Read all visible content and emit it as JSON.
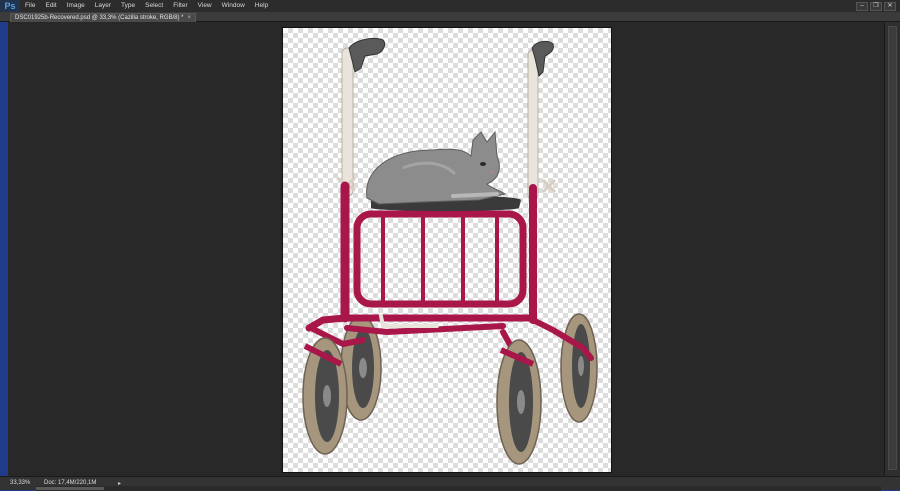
{
  "app": {
    "logo": "Ps",
    "menus": [
      "File",
      "Edit",
      "Image",
      "Layer",
      "Type",
      "Select",
      "Filter",
      "View",
      "Window",
      "Help"
    ],
    "window_controls": [
      "–",
      "❐",
      "✕"
    ]
  },
  "document": {
    "tab_title": "DSC01925b-Recovered.psd @ 33,3% (Cazilla stroke, RGB/8) *",
    "tab_close": "×"
  },
  "status": {
    "zoom": "33,33%",
    "doc_info": "Doc: 17,4M/220,1M",
    "arrow": "▸"
  },
  "colors": {
    "frame": "#a8164a",
    "tire": "#a6967e",
    "cat": "#8c8c8c",
    "handle_grip": "#e8e4dc"
  },
  "icons": {
    "logo": "photoshop-logo-icon",
    "status_menu": "triangle-right-icon"
  }
}
